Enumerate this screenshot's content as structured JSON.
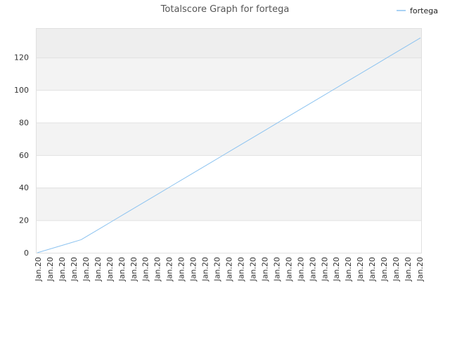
{
  "chart_data": {
    "type": "line",
    "title": "Totalscore Graph for fortega",
    "xlabel": "",
    "ylabel": "",
    "ylim": [
      0,
      138
    ],
    "yticks": [
      0,
      20,
      40,
      60,
      80,
      100,
      120
    ],
    "grid": true,
    "legend_position": "top-right",
    "x_tick_labels": [
      "Jan.20",
      "Jan.20",
      "Jan.20",
      "Jan.20",
      "Jan.20",
      "Jan.20",
      "Jan.20",
      "Jan.20",
      "Jan.20",
      "Jan.20",
      "Jan.20",
      "Jan.20",
      "Jan.20",
      "Jan.20",
      "Jan.20",
      "Jan.20",
      "Jan.20",
      "Jan.20",
      "Jan.20",
      "Jan.20",
      "Jan.20",
      "Jan.20",
      "Jan.20",
      "Jan.20",
      "Jan.20",
      "Jan.20",
      "Jan.20",
      "Jan.20",
      "Jan.20",
      "Jan.20",
      "Jan.20",
      "Jan.20",
      "Jan.20"
    ],
    "series": [
      {
        "name": "fortega",
        "color": "#8cc3f0",
        "values": [
          0,
          2,
          4,
          6,
          8,
          12,
          16,
          20,
          24,
          28,
          32,
          36,
          40,
          44,
          48,
          52,
          56,
          60,
          64,
          68,
          72,
          76,
          80,
          84,
          88,
          92,
          96,
          100,
          104,
          108,
          112,
          116,
          120,
          124,
          128,
          132
        ]
      }
    ],
    "band_colors": [
      "#ffffff",
      "#f3f3f3"
    ],
    "top_band_color": "#eeeeee",
    "grid_color": "#e0e0e0"
  }
}
